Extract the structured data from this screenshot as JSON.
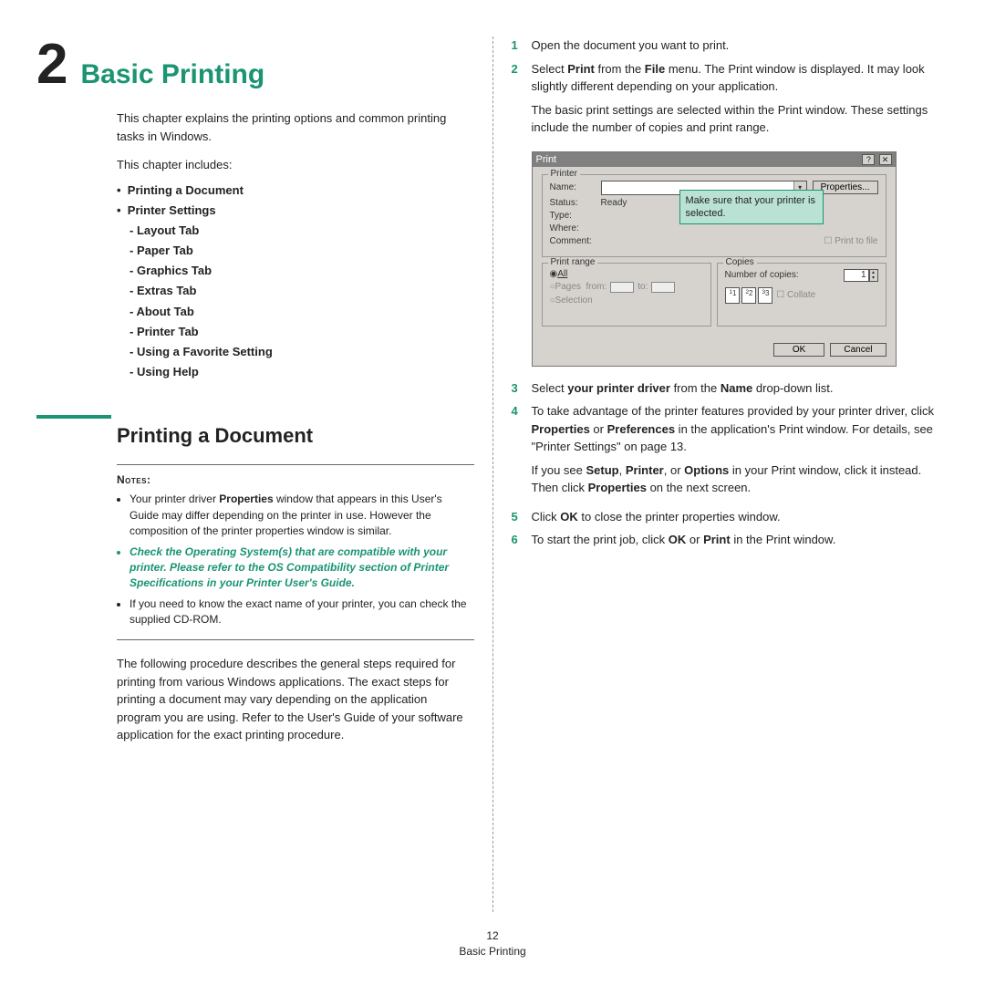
{
  "chapter": {
    "number": "2",
    "title": "Basic Printing"
  },
  "intro": "This chapter explains the printing options and common printing tasks in Windows.",
  "includes_label": "This chapter includes:",
  "toc": {
    "i0": "Printing a Document",
    "i1": "Printer Settings",
    "s0": "Layout Tab",
    "s1": "Paper Tab",
    "s2": "Graphics Tab",
    "s3": "Extras Tab",
    "s4": "About Tab",
    "s5": "Printer Tab",
    "s6": "Using a Favorite Setting",
    "s7": "Using Help"
  },
  "section_title": "Printing a Document",
  "notes": {
    "heading": "Notes:",
    "n1a": "Your printer driver ",
    "n1b": "Properties",
    "n1c": " window that appears in this User's Guide may differ depending on the printer in use. However the composition of the printer properties window is similar.",
    "n2": "Check the Operating System(s) that are compatible with your printer. Please refer to the OS Compatibility section of Printer Specifications in your Printer User's Guide.",
    "n3": "If you need to know the exact name of your printer, you can check the supplied CD-ROM."
  },
  "procedure_intro": "The following procedure describes the general steps required for printing from various Windows applications. The exact steps for printing a document may vary depending on the application program you are using. Refer to the User's Guide of your software application for the exact printing procedure.",
  "steps": {
    "n1": "1",
    "b1": "Open the document you want to print.",
    "n2": "2",
    "b2a": "Select ",
    "b2b": "Print",
    "b2c": " from the ",
    "b2d": "File",
    "b2e": " menu. The Print window is displayed. It may look slightly different depending on your application.",
    "b2f": "The basic print settings are selected within the Print window. These settings include the number of copies and print range.",
    "n3": "3",
    "b3a": "Select ",
    "b3b": "your printer driver",
    "b3c": " from the ",
    "b3d": "Name",
    "b3e": " drop-down list.",
    "n4": "4",
    "b4a": "To take advantage of the printer features provided by your printer driver, click ",
    "b4b": "Properties",
    "b4c": " or ",
    "b4d": "Preferences",
    "b4e": " in the application's Print window. For details, see \"Printer Settings\" on page 13.",
    "b4f": "If you see ",
    "b4g": "Setup",
    "b4h": ", ",
    "b4i": "Printer",
    "b4j": ", or ",
    "b4k": "Options",
    "b4l": " in your Print window, click it instead. Then click ",
    "b4m": "Properties",
    "b4n": " on the next screen.",
    "n5": "5",
    "b5a": "Click ",
    "b5b": "OK",
    "b5c": " to close the printer properties window.",
    "n6": "6",
    "b6a": "To start the print job, click ",
    "b6b": "OK",
    "b6c": " or ",
    "b6d": "Print",
    "b6e": " in the Print window."
  },
  "dialog": {
    "title": "Print",
    "help": "?",
    "close": "✕",
    "printer_legend": "Printer",
    "name_lbl": "Name:",
    "properties_btn": "Properties...",
    "status_lbl": "Status:",
    "status_val": "Ready",
    "type_lbl": "Type:",
    "where_lbl": "Where:",
    "comment_lbl": "Comment:",
    "print_to_file": "Print to file",
    "callout": "Make sure that your printer is selected.",
    "range_legend": "Print range",
    "all": "All",
    "pages": "Pages",
    "from": "from:",
    "to": "to:",
    "selection": "Selection",
    "copies_legend": "Copies",
    "num_copies": "Number of copies:",
    "copies_val": "1",
    "collate": "Collate",
    "p1": "1",
    "p2": "2",
    "p3": "3",
    "ok": "OK",
    "cancel": "Cancel"
  },
  "footer": {
    "page": "12",
    "title": "Basic Printing"
  }
}
